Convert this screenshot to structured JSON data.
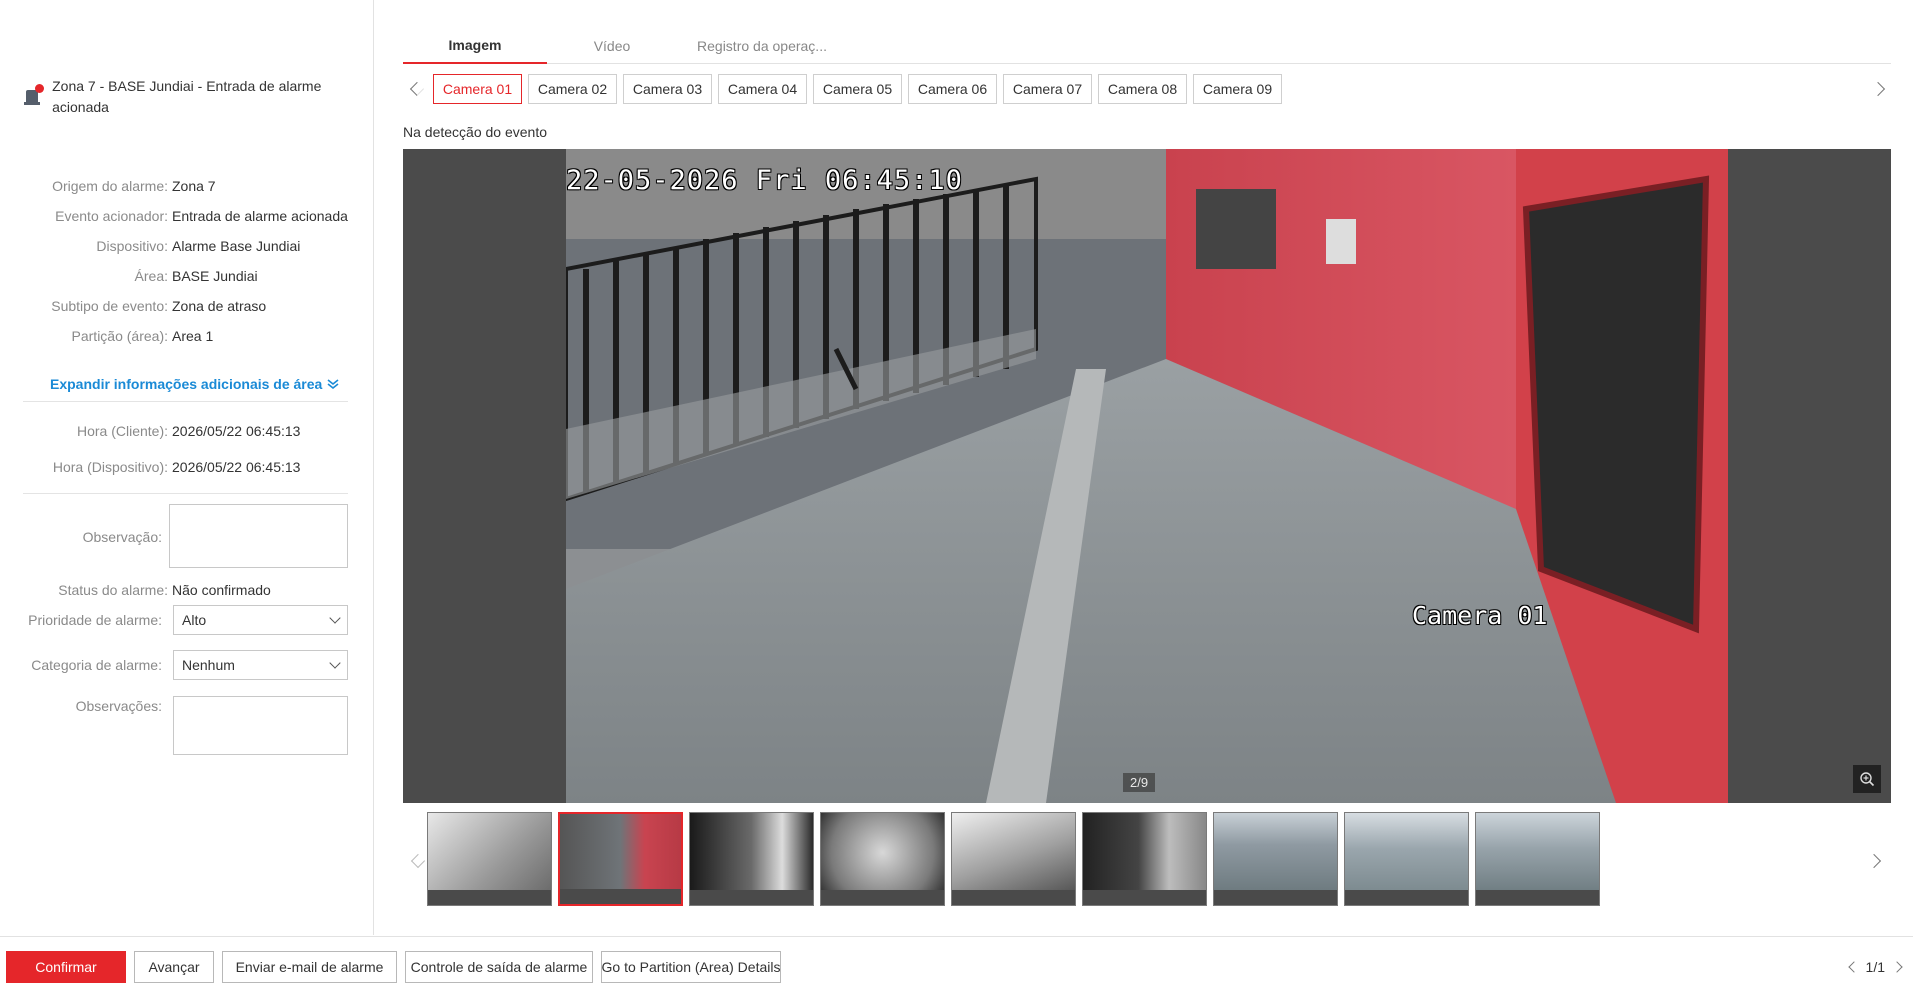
{
  "alarm": {
    "title": "Zona 7 - BASE Jundiai - Entrada de alarme acionada"
  },
  "details": [
    {
      "label": "Origem do alarme:",
      "value": "Zona 7"
    },
    {
      "label": "Evento acionador:",
      "value": "Entrada de alarme acionada"
    },
    {
      "label": "Dispositivo:",
      "value": "Alarme Base Jundiai"
    },
    {
      "label": "Área:",
      "value": "BASE Jundiai"
    },
    {
      "label": "Subtipo de evento:",
      "value": "Zona de atraso"
    },
    {
      "label": "Partição (área):",
      "value": "Area 1"
    }
  ],
  "expand_label": "Expandir informações adicionais de área",
  "times": [
    {
      "label": "Hora (Cliente):",
      "value": "2026/05/22 06:45:13"
    },
    {
      "label": "Hora (Dispositivo):",
      "value": "2026/05/22 06:45:13"
    }
  ],
  "form": {
    "observation_label": "Observação:",
    "status_label": "Status do alarme:",
    "status_value": "Não confirmado",
    "priority_label": "Prioridade de alarme:",
    "priority_value": "Alto",
    "category_label": "Categoria de alarme:",
    "category_value": "Nenhum",
    "remarks_label": "Observações:"
  },
  "tabs": [
    {
      "label": "Imagem",
      "active": true
    },
    {
      "label": "Vídeo",
      "active": false
    },
    {
      "label": "Registro da operaç...",
      "active": false
    }
  ],
  "cameras": [
    "Camera 01",
    "Camera 02",
    "Camera 03",
    "Camera 04",
    "Camera 05",
    "Camera 06",
    "Camera 07",
    "Camera 08",
    "Camera 09"
  ],
  "active_camera": 0,
  "caption": "Na detecção do evento",
  "viewer": {
    "osd_time": "22-05-2026 Fri 06:45:10",
    "osd_camera": "Camera 01",
    "counter": "2/9"
  },
  "thumbnails_active": 1,
  "footer": {
    "confirm": "Confirmar",
    "advance": "Avançar",
    "email": "Enviar e-mail de alarme",
    "output": "Controle de saída de alarme",
    "partition": "Go to Partition (Area) Details",
    "pager": "1/1"
  },
  "colors": {
    "accent": "#e5262a",
    "link": "#1a8ad6"
  }
}
